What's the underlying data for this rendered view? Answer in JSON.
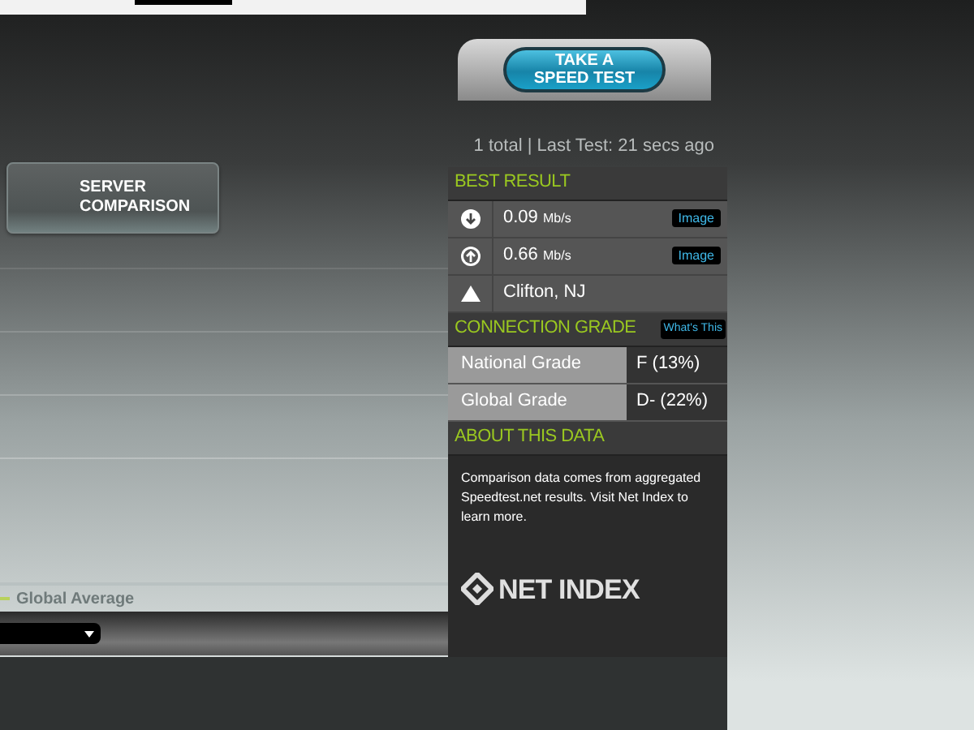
{
  "speed_test_button": "TAKE A\nSPEED TEST",
  "test_summary": "1 total | Last Test: 21 secs ago",
  "server_comparison_button": "SERVER\nCOMPARISON",
  "legend": "Global Average",
  "best_result": {
    "title": "BEST RESULT",
    "rows": [
      {
        "kind": "download",
        "value": "0.09",
        "unit": "Mb/s",
        "button": "Image"
      },
      {
        "kind": "upload",
        "value": "0.66",
        "unit": "Mb/s",
        "button": "Image"
      },
      {
        "kind": "location",
        "value": "Clifton, NJ"
      }
    ]
  },
  "connection_grade": {
    "title": "CONNECTION GRADE",
    "help_button": "What's This",
    "rows": [
      {
        "label": "National Grade",
        "value": "F (13%)"
      },
      {
        "label": "Global Grade",
        "value": "D- (22%)"
      }
    ]
  },
  "about": {
    "title": "ABOUT THIS DATA",
    "text": "Comparison data comes from aggregated Speedtest.net results. Visit Net Index to learn more.",
    "logo": "NET INDEX"
  }
}
